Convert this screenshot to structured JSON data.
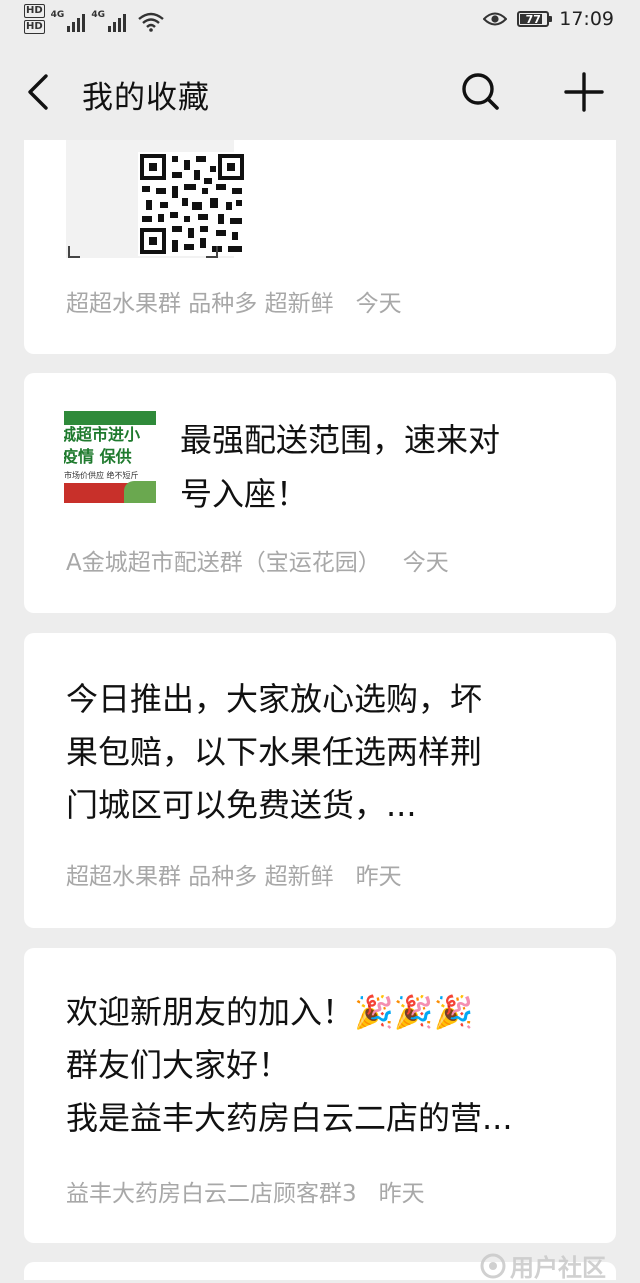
{
  "status_bar": {
    "hd1": "HD",
    "hd2": "HD",
    "net1": "4G",
    "net2": "4G",
    "battery": "77",
    "time": "17:09"
  },
  "header": {
    "title": "我的收藏"
  },
  "icons": {
    "back": "back-arrow-icon",
    "search": "search-icon",
    "add": "plus-icon"
  },
  "favorites": [
    {
      "type": "image",
      "source": "超超水果群 品种多 超新鲜",
      "time": "今天"
    },
    {
      "type": "link",
      "title_line1": "最强配送范围，速来对",
      "title_line2": "号入座！",
      "thumb_line1": "城超市进小",
      "thumb_line2": "疫情  保供",
      "thumb_line3": "市场价供应   绝不短斤",
      "source": "A金城超市配送群（宝运花园）",
      "time": "今天"
    },
    {
      "type": "text",
      "line1": "今日推出，大家放心选购，坏",
      "line2": "果包赔，以下水果任选两样荆",
      "line3": "门城区可以免费送货，...",
      "source": "超超水果群 品种多 超新鲜",
      "time": "昨天"
    },
    {
      "type": "text",
      "line1": "欢迎新朋友的加入！🎉🎉🎉",
      "line2": "群友们大家好！",
      "line3": "我是益丰大药房白云二店的营...",
      "source": "益丰大药房白云二店顾客群3",
      "time": "昨天"
    }
  ],
  "watermark": "用户社区"
}
